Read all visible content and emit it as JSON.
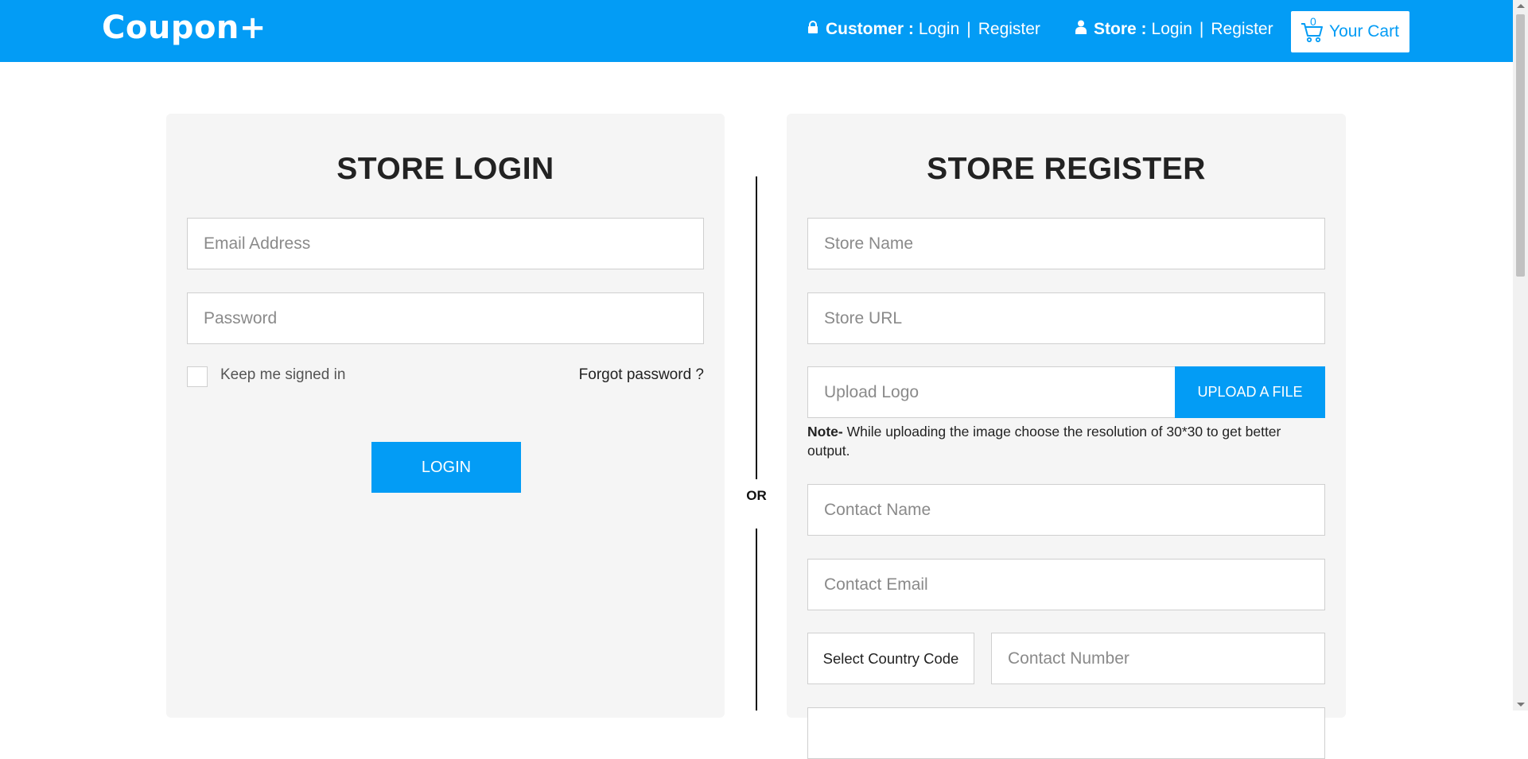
{
  "header": {
    "logo": "Coupon+",
    "customer_label": "Customer :",
    "customer_login": "Login",
    "customer_register": "Register",
    "store_label": "Store :",
    "store_login": "Login",
    "store_register": "Register",
    "separator": "|",
    "cart_label": "Your Cart",
    "cart_count": "0",
    "lock_icon": "lock-icon",
    "user_icon": "user-icon",
    "cart_icon": "cart-icon"
  },
  "login": {
    "title": "STORE LOGIN",
    "email_placeholder": "Email Address",
    "password_placeholder": "Password",
    "keep_signed_in": "Keep me signed in",
    "forgot_password": "Forgot password ?",
    "login_button": "LOGIN"
  },
  "divider": {
    "or_label": "OR"
  },
  "register": {
    "title": "STORE REGISTER",
    "store_name_placeholder": "Store Name",
    "store_url_placeholder": "Store URL",
    "upload_logo_placeholder": "Upload Logo",
    "upload_button": "UPLOAD A FILE",
    "note_label": "Note-",
    "note_text": " While uploading the image choose the resolution of 30*30 to get better output.",
    "contact_name_placeholder": "Contact Name",
    "contact_email_placeholder": "Contact Email",
    "country_code_select": "Select Country Code",
    "contact_number_placeholder": "Contact Number"
  },
  "colors": {
    "brand": "#039cf5",
    "panel_bg": "#f5f5f5"
  }
}
